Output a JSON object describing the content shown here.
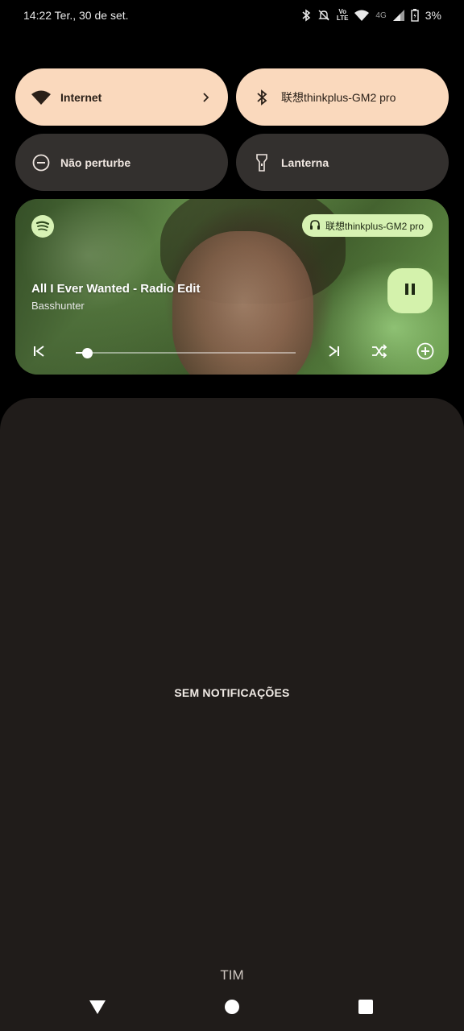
{
  "status_bar": {
    "time_date": "14:22 Ter., 30 de set.",
    "volte_top": "Vo",
    "volte_bottom": "LTE",
    "network": "4G",
    "battery": "3%",
    "icons": [
      "bluetooth-icon",
      "silent-bell-icon",
      "volte-icon",
      "wifi-icon",
      "signal-icon",
      "battery-icon"
    ]
  },
  "quick_settings": {
    "tiles": [
      {
        "label": "Internet",
        "icon": "wifi-icon",
        "state": "on",
        "has_chevron": true
      },
      {
        "label": "联想thinkplus-GM2 pro",
        "icon": "bluetooth-icon",
        "state": "on"
      },
      {
        "label": "Não perturbe",
        "icon": "do-not-disturb-icon",
        "state": "off"
      },
      {
        "label": "Lanterna",
        "icon": "flashlight-icon",
        "state": "off"
      }
    ]
  },
  "media_player": {
    "app_icon": "spotify-icon",
    "output_device": "联想thinkplus-GM2 pro",
    "track_title": "All I Ever Wanted - Radio Edit",
    "artist": "Basshunter",
    "progress": 0.05,
    "controls": [
      "previous-icon",
      "next-icon",
      "shuffle-icon",
      "add-icon",
      "pause-icon"
    ]
  },
  "notifications": {
    "empty_text": "SEM NOTIFICAÇÕES",
    "carrier": "TIM"
  },
  "colors": {
    "tile_on": "#fad9bd",
    "tile_off": "#33302e",
    "panel_bg": "#201c1a",
    "media_accent": "#d4f2ac"
  }
}
